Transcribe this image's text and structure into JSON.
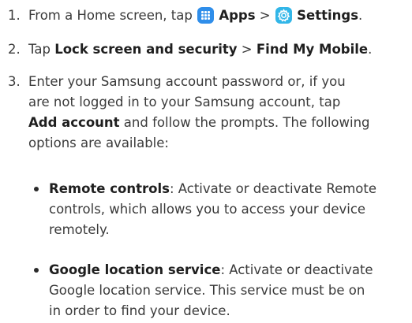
{
  "steps": [
    {
      "num": "1.",
      "pre": "From a Home screen, tap ",
      "apps_label": "Apps",
      "sep": " > ",
      "settings_label": "Settings",
      "post": "."
    },
    {
      "num": "2.",
      "pre": "Tap ",
      "lock_label": "Lock screen and security",
      "sep": " > ",
      "find_label": "Find My Mobile",
      "post": "."
    },
    {
      "num": "3.",
      "line1": "Enter your Samsung account password or, if you",
      "line2": "are not logged in to your Samsung account, tap",
      "add_label": "Add account",
      "line3_post": " and follow the prompts. The following",
      "line4": "options are available:"
    }
  ],
  "bullets": [
    {
      "term": "Remote controls",
      "line1_post": ": Activate or deactivate Remote",
      "line2": "controls, which allows you to access your device",
      "line3": "remotely."
    },
    {
      "term": "Google location service",
      "line1_post": ": Activate or deactivate",
      "line2": "Google location service. This service must be on",
      "line3": "in order to find your device."
    }
  ],
  "icons": {
    "apps": "apps-grid-icon",
    "settings": "settings-gear-icon"
  },
  "colors": {
    "apps_icon": "#2f8eea",
    "settings_icon": "#32b6e8"
  }
}
